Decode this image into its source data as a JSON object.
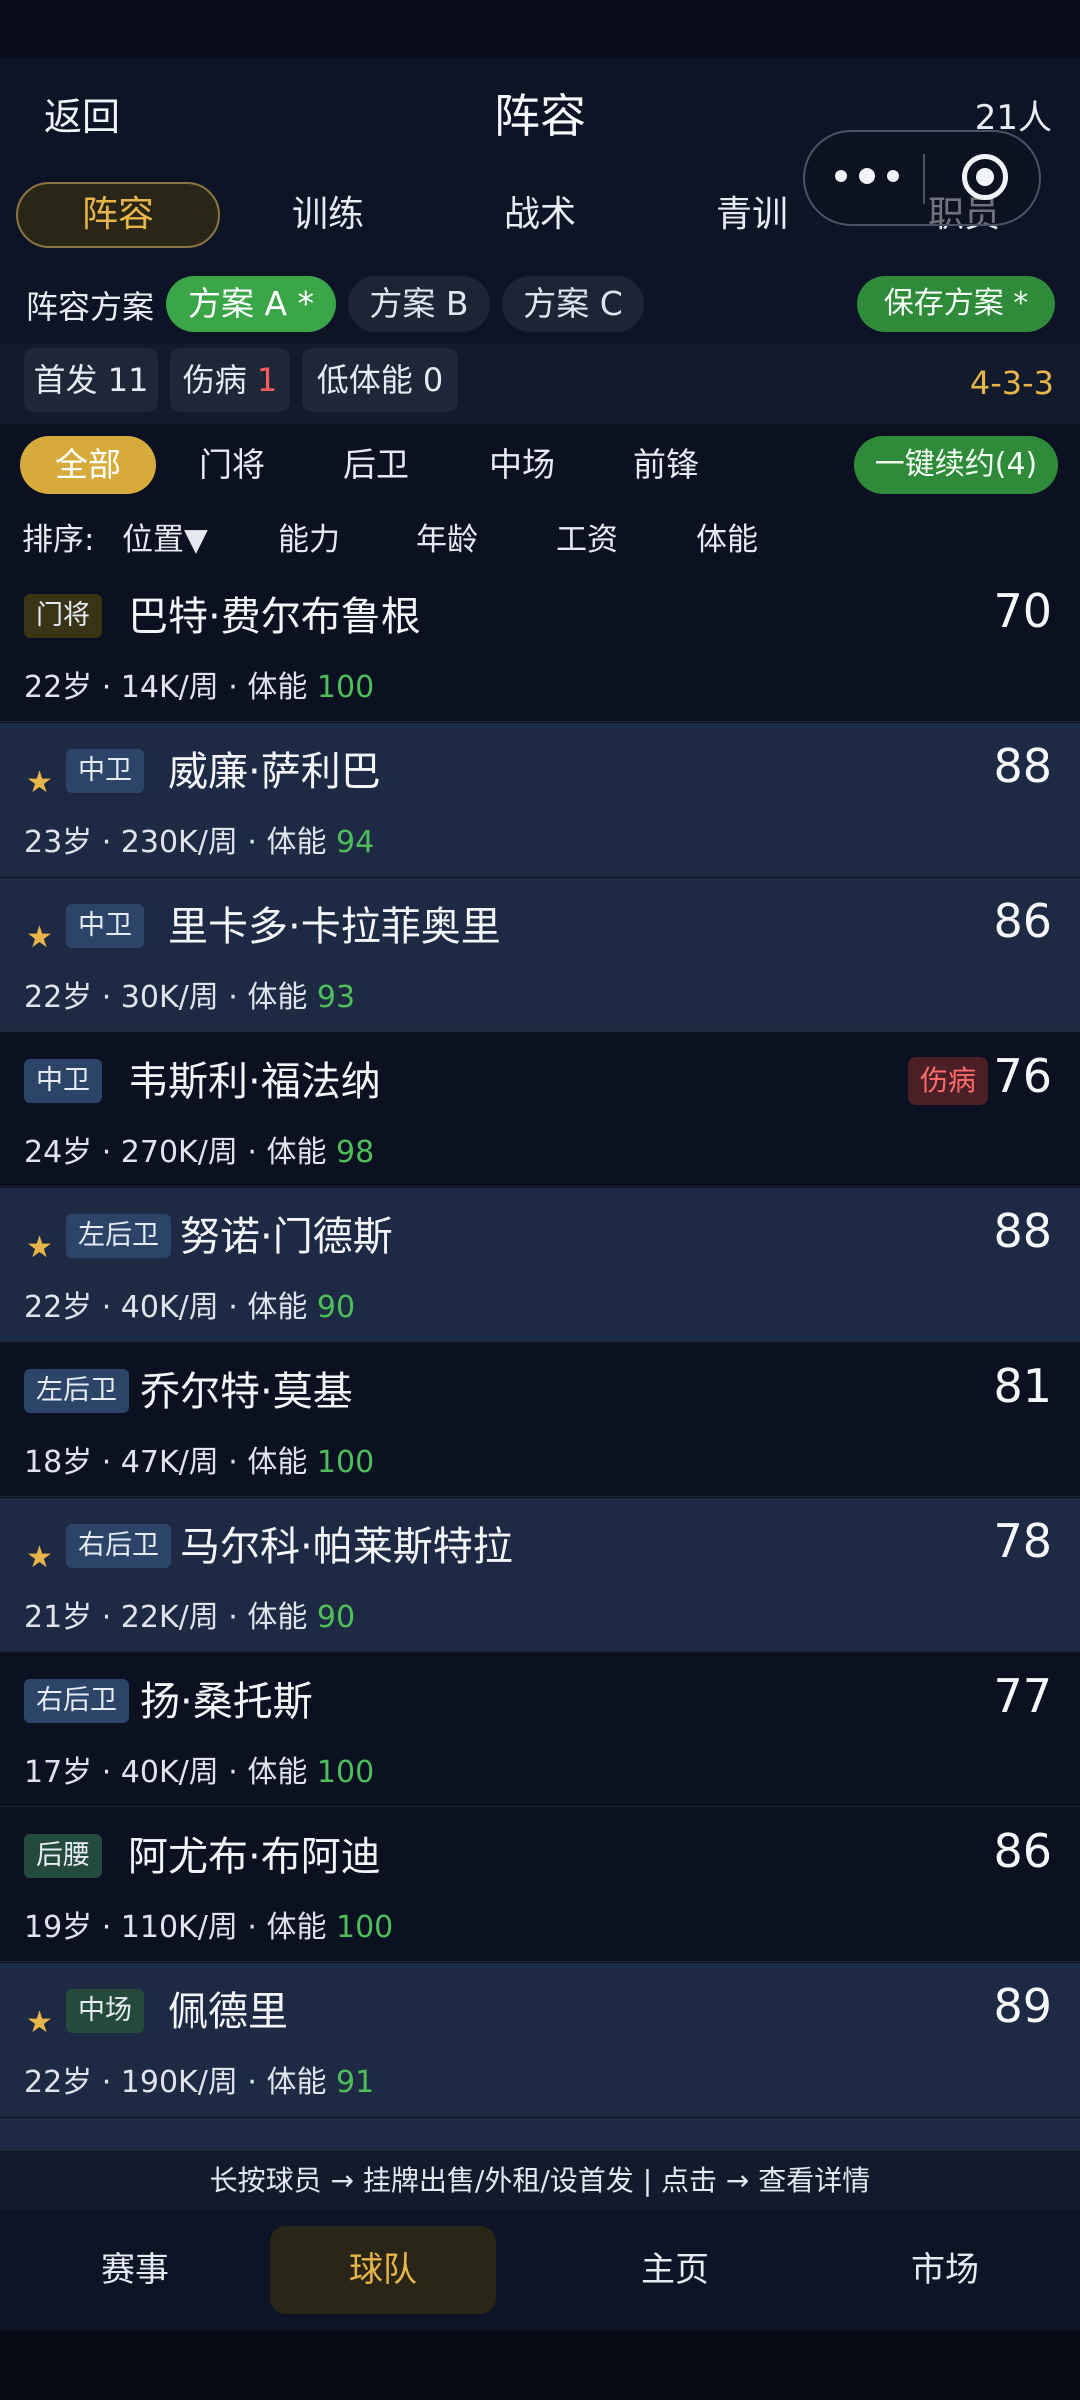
{
  "header": {
    "back": "返回",
    "title": "阵容",
    "count": "21人"
  },
  "tabs": [
    {
      "label": "阵容",
      "active": true
    },
    {
      "label": "训练"
    },
    {
      "label": "战术"
    },
    {
      "label": "青训"
    },
    {
      "label": "职员"
    }
  ],
  "scheme": {
    "label": "阵容方案",
    "options": [
      {
        "label": "方案 A *",
        "active": true
      },
      {
        "label": "方案 B"
      },
      {
        "label": "方案 C"
      }
    ],
    "save": "保存方案 *"
  },
  "stats": {
    "starters": "首发 11",
    "injured_label": "伤病",
    "injured_count": "1",
    "low_stamina": "低体能 0",
    "formation": "4-3-3"
  },
  "filters": [
    "全部",
    "门将",
    "后卫",
    "中场",
    "前锋"
  ],
  "renew": "一键续约(4)",
  "sort": {
    "label": "排序:",
    "position": "位置▼",
    "ability": "能力",
    "age": "年龄",
    "salary": "工资",
    "stamina": "体能"
  },
  "players": [
    {
      "pos": "门将",
      "name": "巴特·费尔布鲁根",
      "age": "22岁",
      "wage": "14K/周",
      "stamina_label": "体能",
      "stamina": "100",
      "rating": "70",
      "starter": false
    },
    {
      "pos": "中卫",
      "name": "威廉·萨利巴",
      "age": "23岁",
      "wage": "230K/周",
      "stamina_label": "体能",
      "stamina": "94",
      "rating": "88",
      "starter": true
    },
    {
      "pos": "中卫",
      "name": "里卡多·卡拉菲奥里",
      "age": "22岁",
      "wage": "30K/周",
      "stamina_label": "体能",
      "stamina": "93",
      "rating": "86",
      "starter": true
    },
    {
      "pos": "中卫",
      "name": "韦斯利·福法纳",
      "age": "24岁",
      "wage": "270K/周",
      "stamina_label": "体能",
      "stamina": "98",
      "rating": "76",
      "starter": false,
      "tag": "伤病"
    },
    {
      "pos": "左后卫",
      "name": "努诺·门德斯",
      "age": "22岁",
      "wage": "40K/周",
      "stamina_label": "体能",
      "stamina": "90",
      "rating": "88",
      "starter": true
    },
    {
      "pos": "左后卫",
      "name": "乔尔特·莫基",
      "age": "18岁",
      "wage": "47K/周",
      "stamina_label": "体能",
      "stamina": "100",
      "rating": "81",
      "starter": false
    },
    {
      "pos": "右后卫",
      "name": "马尔科·帕莱斯特拉",
      "age": "21岁",
      "wage": "22K/周",
      "stamina_label": "体能",
      "stamina": "90",
      "rating": "78",
      "starter": true
    },
    {
      "pos": "右后卫",
      "name": "扬·桑托斯",
      "age": "17岁",
      "wage": "40K/周",
      "stamina_label": "体能",
      "stamina": "100",
      "rating": "77",
      "starter": false
    },
    {
      "pos": "后腰",
      "name": "阿尤布·布阿迪",
      "age": "19岁",
      "wage": "110K/周",
      "stamina_label": "体能",
      "stamina": "100",
      "rating": "86",
      "starter": false
    },
    {
      "pos": "中场",
      "name": "佩德里",
      "age": "22岁",
      "wage": "190K/周",
      "stamina_label": "体能",
      "stamina": "91",
      "rating": "89",
      "starter": true
    }
  ],
  "hint": "长按球员 → 挂牌出售/外租/设首发 | 点击 → 查看详情",
  "nav": [
    {
      "label": "赛事"
    },
    {
      "label": "球队",
      "active": true
    },
    {
      "label": "主页"
    },
    {
      "label": "市场"
    }
  ],
  "colors": {
    "accent": "#e7b54a",
    "green": "#3aa647",
    "stamina": "#4fbe5a",
    "injury": "#ff5c5c",
    "starter_row": "#1e2a44",
    "dark_row": "#0b1120"
  }
}
